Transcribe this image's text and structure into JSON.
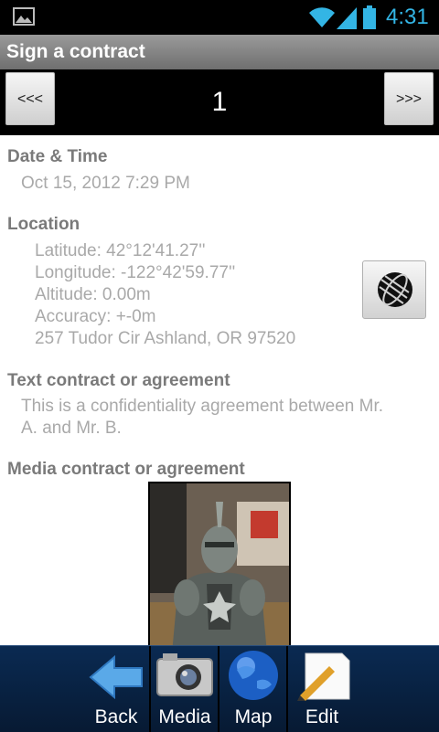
{
  "status_bar": {
    "time": "4:31"
  },
  "title": "Sign a contract",
  "pager": {
    "prev_label": "<<<",
    "next_label": ">>>",
    "page": "1"
  },
  "datetime": {
    "heading": "Date & Time",
    "value": "Oct 15, 2012 7:29 PM"
  },
  "location": {
    "heading": "Location",
    "latitude": "Latitude: 42°12'41.27''",
    "longitude": "Longitude: -122°42'59.77''",
    "altitude": "Altitude: 0.00m",
    "accuracy": "Accuracy: +-0m",
    "address": "257 Tudor Cir Ashland, OR 97520"
  },
  "text_contract": {
    "heading": "Text contract or agreement",
    "line1": "This is a confidentiality agreement between Mr.",
    "line2": "A. and Mr. B."
  },
  "media_contract": {
    "heading": "Media contract or agreement"
  },
  "bottom_bar": {
    "tabs": [
      {
        "label": "Back",
        "icon": "back-arrow-icon"
      },
      {
        "label": "Media",
        "icon": "camera-icon"
      },
      {
        "label": "Map",
        "icon": "globe-icon"
      },
      {
        "label": "Edit",
        "icon": "edit-pencil-icon"
      }
    ]
  },
  "colors": {
    "accent_time": "#33b5e5",
    "bottom_bar": "#0a2a52"
  }
}
